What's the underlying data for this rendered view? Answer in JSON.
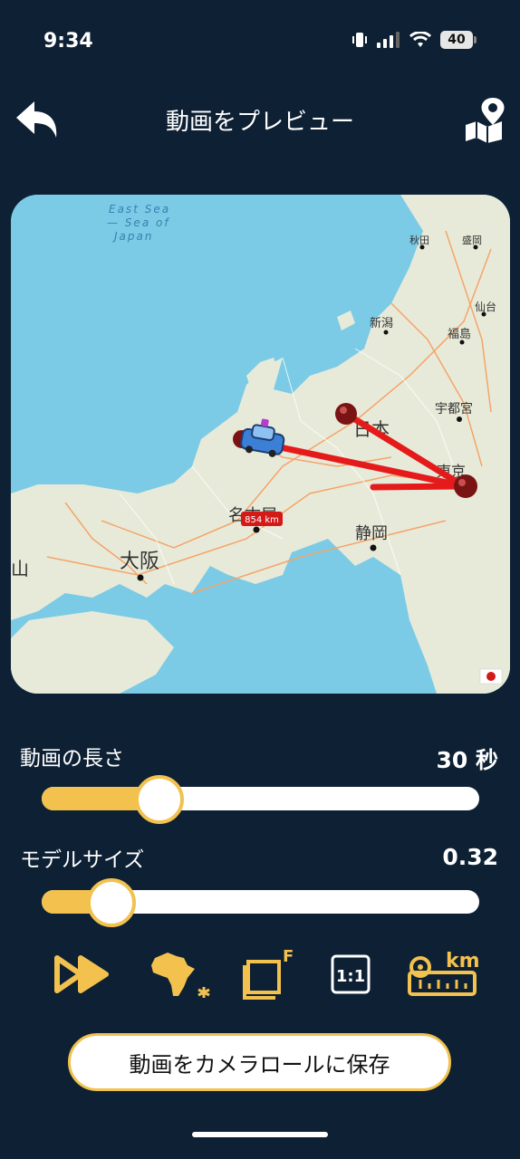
{
  "status": {
    "time": "9:34",
    "battery": "40"
  },
  "nav": {
    "title": "動画をプレビュー"
  },
  "map": {
    "sea_label_lines": [
      "East Sea",
      "— Sea of",
      "Japan"
    ],
    "cities": {
      "akita": "秋田",
      "morioka": "盛岡",
      "sendai": "仙台",
      "niigata": "新潟",
      "fukushima": "福島",
      "utsunomiya": "宇都宮",
      "nihon": "日本",
      "tokyo": "東京",
      "nagoya": "名古屋",
      "shizuoka": "静岡",
      "osaka": "大阪",
      "yama": "山"
    },
    "distance_badge": "854 km"
  },
  "sliders": {
    "duration": {
      "label": "動画の長さ",
      "value": "30 秒",
      "fraction": 0.27
    },
    "model_size": {
      "label": "モデルサイズ",
      "value": "0.32",
      "fraction": 0.16
    }
  },
  "toolbar": {
    "frame_sup": "F",
    "ratio": "1:1",
    "unit": "km"
  },
  "save_button": {
    "label": "動画をカメラロールに保存"
  },
  "colors": {
    "background": "#0d2034",
    "accent": "#f2c14e",
    "route": "#e51b1b",
    "sea": "#7bcbe6",
    "land": "#e8ead9"
  }
}
